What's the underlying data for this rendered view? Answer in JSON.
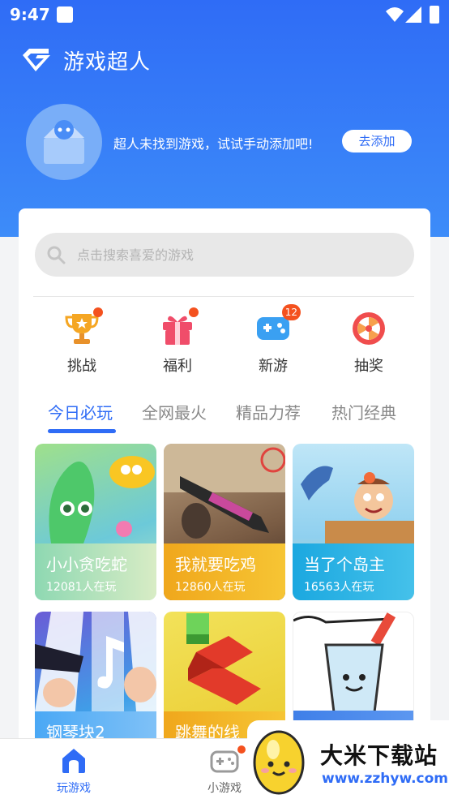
{
  "status_bar": {
    "time": "9:47"
  },
  "app": {
    "title": "游戏超人"
  },
  "empty_state": {
    "message": "超人未找到游戏，试试手动添加吧!",
    "add_button": "去添加"
  },
  "search": {
    "placeholder": "点击搜索喜爱的游戏"
  },
  "quick_actions": [
    {
      "label": "挑战",
      "icon": "trophy-icon",
      "badge": ""
    },
    {
      "label": "福利",
      "icon": "gift-icon",
      "badge": ""
    },
    {
      "label": "新游",
      "icon": "gamepad-icon",
      "badge": "12"
    },
    {
      "label": "抽奖",
      "icon": "lottery-wheel-icon",
      "badge": ""
    }
  ],
  "tabs": [
    "今日必玩",
    "全网最火",
    "精品力荐",
    "热门经典"
  ],
  "games": [
    {
      "name": "小小贪吃蛇",
      "players": "12081人在玩"
    },
    {
      "name": "我就要吃鸡",
      "players": "12860人在玩"
    },
    {
      "name": "当了个岛主",
      "players": "16563人在玩"
    },
    {
      "name": "钢琴块2",
      "players": ""
    },
    {
      "name": "跳舞的线",
      "players": ""
    },
    {
      "name": "",
      "players": ""
    }
  ],
  "bottom_nav": [
    {
      "label": "玩游戏",
      "icon": "home-icon"
    },
    {
      "label": "小游戏",
      "icon": "gamepad-icon"
    }
  ],
  "watermark": {
    "title": "大米下载站",
    "url": "www.zzhyw.com"
  },
  "colors": {
    "primary": "#2f6cf6",
    "badge": "#f4511e"
  }
}
